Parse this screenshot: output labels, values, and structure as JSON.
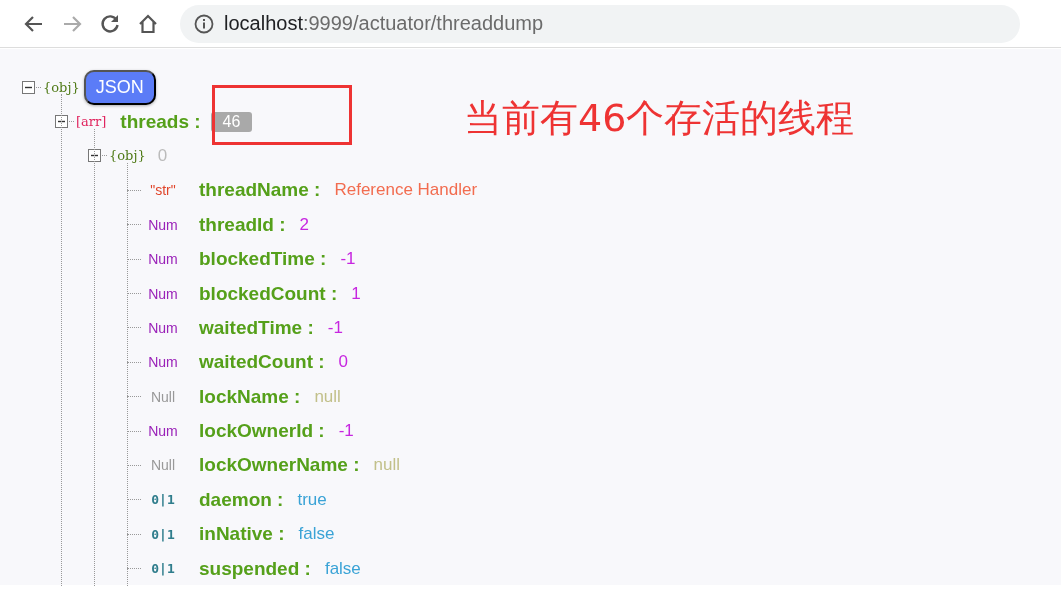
{
  "address_bar": {
    "host": "localhost",
    "path": ":9999/actuator/threaddump"
  },
  "tree": {
    "kind": "obj",
    "type": "{obj}",
    "expanded": true,
    "badge": "JSON",
    "children": [
      {
        "kind": "arr",
        "type": "[arr]",
        "key": "threads :",
        "count": "46",
        "expanded": true,
        "children": [
          {
            "kind": "obj",
            "type": "{obj}",
            "index": "0",
            "expanded": true,
            "children": [
              {
                "kind": "str",
                "type": "\"str\"",
                "key": "threadName :",
                "value": "Reference Handler"
              },
              {
                "kind": "num",
                "type": "Num",
                "key": "threadId :",
                "value": "2"
              },
              {
                "kind": "num",
                "type": "Num",
                "key": "blockedTime :",
                "value": "-1"
              },
              {
                "kind": "num",
                "type": "Num",
                "key": "blockedCount :",
                "value": "1"
              },
              {
                "kind": "num",
                "type": "Num",
                "key": "waitedTime :",
                "value": "-1"
              },
              {
                "kind": "num",
                "type": "Num",
                "key": "waitedCount :",
                "value": "0"
              },
              {
                "kind": "null",
                "type": "Null",
                "key": "lockName :",
                "value": "null"
              },
              {
                "kind": "num",
                "type": "Num",
                "key": "lockOwnerId :",
                "value": "-1"
              },
              {
                "kind": "null",
                "type": "Null",
                "key": "lockOwnerName :",
                "value": "null"
              },
              {
                "kind": "bool",
                "type": "0|1",
                "key": "daemon :",
                "value": "true"
              },
              {
                "kind": "bool",
                "type": "0|1",
                "key": "inNative :",
                "value": "false"
              },
              {
                "kind": "bool",
                "type": "0|1",
                "key": "suspended :",
                "value": "false"
              }
            ]
          }
        ]
      }
    ]
  },
  "annotation": {
    "text": "当前有46个存活的线程"
  }
}
